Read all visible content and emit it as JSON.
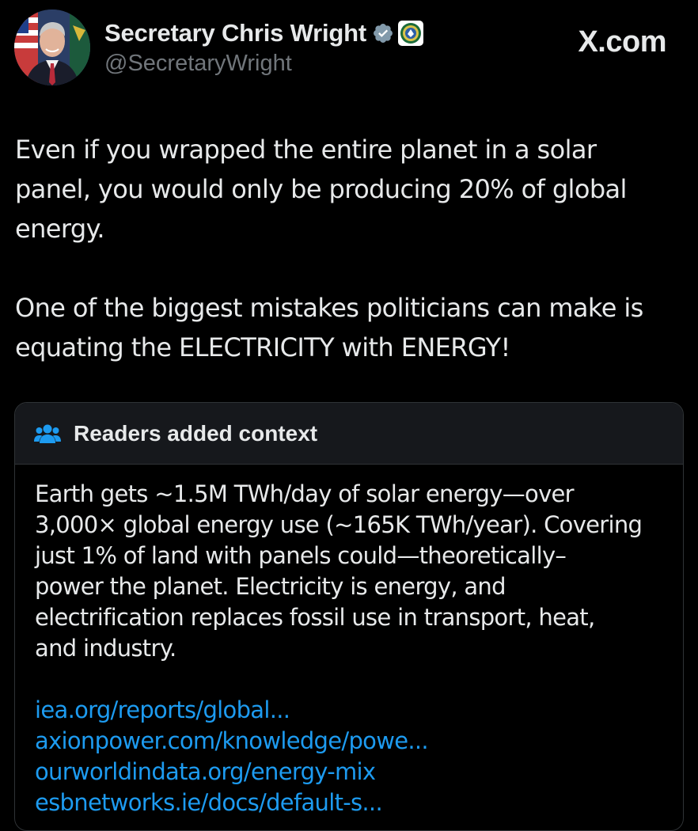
{
  "account": {
    "display_name": "Secretary Chris Wright",
    "handle": "@SecretaryWright"
  },
  "brand": "X.com",
  "post": {
    "paragraph_1": "Even if you wrapped the entire planet in a solar\npanel, you would only be producing 20% of global\nenergy.",
    "paragraph_2": "One of the biggest mistakes politicians can make is\nequating the ELECTRICITY with ENERGY!"
  },
  "community_note": {
    "title": "Readers added context",
    "body": "Earth gets ~1.5M TWh/day of solar energy—over\n3,000× global energy use (~165K TWh/year). Covering\njust 1% of land with panels could—theoretically–\npower the planet. Electricity is energy, and\nelectrification replaces fossil use in transport, heat,\nand industry.",
    "links": [
      "iea.org/reports/global...",
      "axionpower.com/knowledge/powe...",
      "ourworldindata.org/energy-mix",
      "esbnetworks.ie/docs/default-s..."
    ]
  },
  "icons": {
    "verified": "gray-verified-badge-icon",
    "affiliate": "department-seal-icon",
    "note": "people-group-icon"
  },
  "colors": {
    "background": "#000000",
    "text": "#e7e9ea",
    "secondary_text": "#71767b",
    "link": "#1d9bf0",
    "note_header": "#16181c",
    "border": "#2f3336",
    "verified_badge": "#829aab"
  }
}
